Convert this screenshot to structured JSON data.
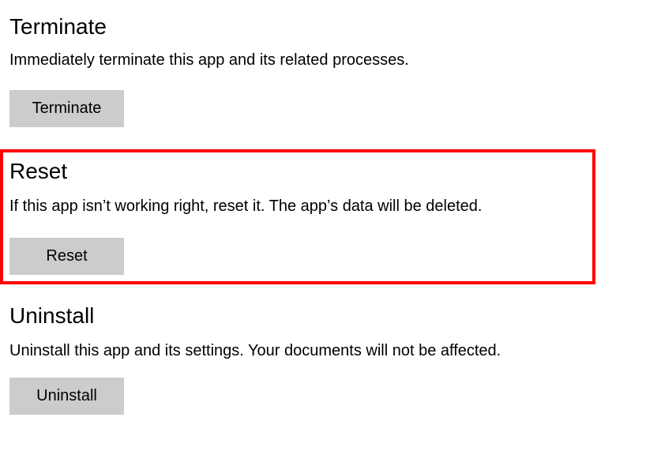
{
  "terminate": {
    "heading": "Terminate",
    "description": "Immediately terminate this app and its related processes.",
    "button_label": "Terminate"
  },
  "reset": {
    "heading": "Reset",
    "description": "If this app isn’t working right, reset it. The app’s data will be deleted.",
    "button_label": "Reset"
  },
  "uninstall": {
    "heading": "Uninstall",
    "description": "Uninstall this app and its settings. Your documents will not be affected.",
    "button_label": "Uninstall"
  }
}
